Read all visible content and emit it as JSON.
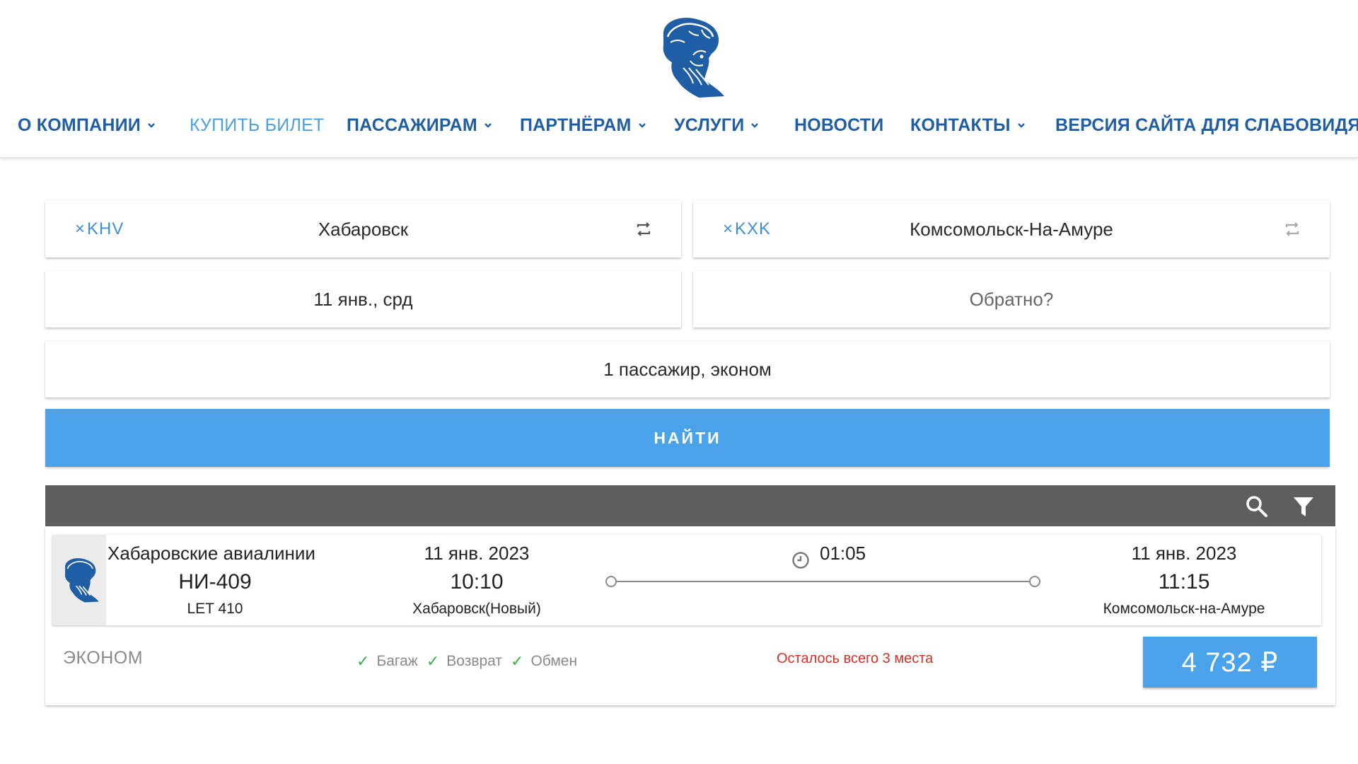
{
  "nav": {
    "items": [
      {
        "label": "О КОМПАНИИ",
        "dropdown": true,
        "active": false
      },
      {
        "label": "КУПИТЬ БИЛЕТ",
        "dropdown": false,
        "active": true
      },
      {
        "label": "ПАССАЖИРАМ",
        "dropdown": true,
        "active": false
      },
      {
        "label": "ПАРТНЁРАМ",
        "dropdown": true,
        "active": false
      },
      {
        "label": "УСЛУГИ",
        "dropdown": true,
        "active": false
      },
      {
        "label": "НОВОСТИ",
        "dropdown": false,
        "active": false
      },
      {
        "label": "КОНТАКТЫ",
        "dropdown": true,
        "active": false
      },
      {
        "label": "ВЕРСИЯ САЙТА ДЛЯ СЛАБОВИДЯЩИХ",
        "dropdown": false,
        "active": false
      }
    ]
  },
  "search": {
    "from": {
      "code": "KHV",
      "city": "Хабаровск",
      "clear_glyph": "×"
    },
    "to": {
      "code": "KXK",
      "city": "Комсомольск-На-Амуре",
      "clear_glyph": "×"
    },
    "depart_date": "11 янв., срд",
    "return_placeholder": "Обратно?",
    "passengers": "1 пассажир, эконом",
    "find_label": "НАЙТИ"
  },
  "results": {
    "toolbar_icons": [
      "search-icon",
      "filter-icon"
    ],
    "flight": {
      "airline": "Хабаровские авиалинии",
      "flight_number": "НИ-409",
      "aircraft": "LET 410",
      "depart_date": "11 янв. 2023",
      "depart_time": "10:10",
      "depart_airport": "Хабаровск(Новый)",
      "duration": "01:05",
      "arrive_date": "11 янв. 2023",
      "arrive_time": "11:15",
      "arrive_airport": "Комсомольск-на-Амуре",
      "fare_class": "ЭКОНОМ",
      "features": [
        "Багаж",
        "Возврат",
        "Обмен"
      ],
      "check_glyph": "✓",
      "seats_left": "Осталось всего 3 места",
      "price": "4 732 ₽"
    }
  },
  "colors": {
    "brand": "#1f5ea5",
    "accent": "#4aa3ea",
    "toolbar": "#5e5e5e",
    "warning": "#d93025",
    "check": "#3cb043"
  }
}
